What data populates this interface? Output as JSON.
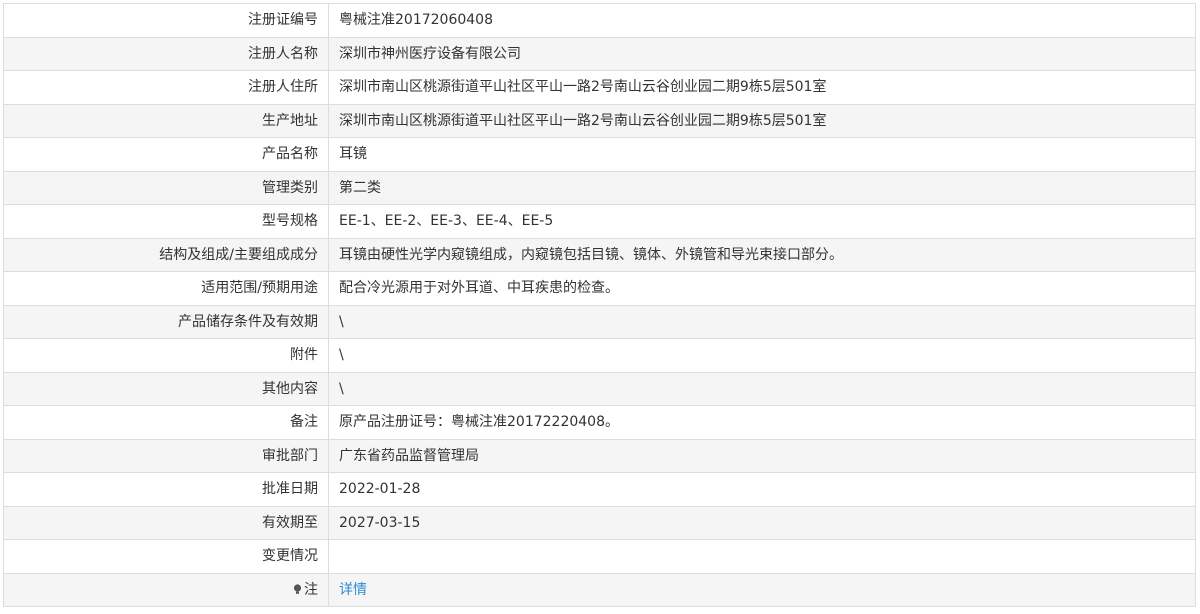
{
  "record": {
    "rows": [
      {
        "label": "注册证编号",
        "value": "粤械注准20172060408"
      },
      {
        "label": "注册人名称",
        "value": "深圳市神州医疗设备有限公司"
      },
      {
        "label": "注册人住所",
        "value": "深圳市南山区桃源街道平山社区平山一路2号南山云谷创业园二期9栋5层501室"
      },
      {
        "label": "生产地址",
        "value": "深圳市南山区桃源街道平山社区平山一路2号南山云谷创业园二期9栋5层501室"
      },
      {
        "label": "产品名称",
        "value": "耳镜"
      },
      {
        "label": "管理类别",
        "value": "第二类"
      },
      {
        "label": "型号规格",
        "value": "EE-1、EE-2、EE-3、EE-4、EE-5"
      },
      {
        "label": "结构及组成/主要组成成分",
        "value": "耳镜由硬性光学内窥镜组成，内窥镜包括目镜、镜体、外镜管和导光束接口部分。"
      },
      {
        "label": "适用范围/预期用途",
        "value": "配合冷光源用于对外耳道、中耳疾患的检查。"
      },
      {
        "label": "产品储存条件及有效期",
        "value": "\\"
      },
      {
        "label": "附件",
        "value": "\\"
      },
      {
        "label": "其他内容",
        "value": "\\"
      },
      {
        "label": "备注",
        "value": "原产品注册证号：粤械注准20172220408。"
      },
      {
        "label": "审批部门",
        "value": "广东省药品监督管理局"
      },
      {
        "label": "批准日期",
        "value": "2022-01-28"
      },
      {
        "label": "有效期至",
        "value": "2027-03-15"
      },
      {
        "label": "变更情况",
        "value": ""
      }
    ],
    "note": {
      "label": "注",
      "icon": "note-bulb-icon",
      "link_text": "详情"
    }
  },
  "colors": {
    "border": "#dddddd",
    "row_alt": "#f5f5f5",
    "text": "#333333",
    "link": "#2a8bd5"
  }
}
